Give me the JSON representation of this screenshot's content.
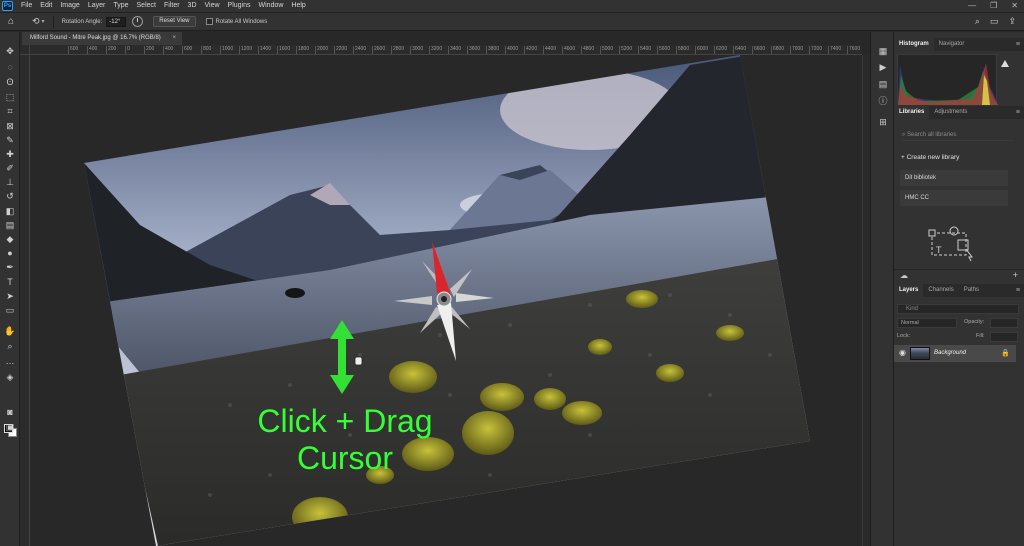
{
  "app": {
    "logo": "Ps",
    "menu": [
      "File",
      "Edit",
      "Image",
      "Layer",
      "Type",
      "Select",
      "Filter",
      "3D",
      "View",
      "Plugins",
      "Window",
      "Help"
    ],
    "window_controls": [
      "—",
      "❐",
      "✕"
    ]
  },
  "options": {
    "rotation_label": "Rotation Angle:",
    "rotation_value": "-12°",
    "reset_view": "Reset View",
    "rotate_all_windows": "Rotate All Windows"
  },
  "document": {
    "tab_title": "Milford Sound - Mitre Peak.jpg @ 16.7% (RGB/8)",
    "tab_close": "×"
  },
  "ruler": {
    "ticks": [
      "600",
      "400",
      "200",
      "0",
      "200",
      "400",
      "600",
      "800",
      "1000",
      "1200",
      "1400",
      "1600",
      "1800",
      "2000",
      "2200",
      "2400",
      "2600",
      "2800",
      "3000",
      "3200",
      "3400",
      "3600",
      "3800",
      "4000",
      "4200",
      "4400",
      "4600",
      "4800",
      "5000",
      "5200",
      "5400",
      "5600",
      "5800",
      "6000",
      "6200",
      "6400",
      "6600",
      "6800",
      "7000",
      "7200",
      "7400",
      "7600",
      "7800"
    ]
  },
  "overlay": {
    "line1": "Click + Drag",
    "line2": "Cursor",
    "color": "#35ff35"
  },
  "panels": {
    "top_tabs": [
      "Histogram",
      "Navigator"
    ],
    "library_tabs": [
      "Libraries",
      "Adjustments"
    ],
    "library_search_placeholder": "Search all libraries",
    "create_library": "Create new library",
    "libraries": [
      "Dit bibliotek",
      "HMC CC"
    ],
    "layer_tabs": [
      "Layers",
      "Channels",
      "Paths"
    ],
    "layer_search": "Kind",
    "blend_mode": "Normal",
    "opacity_label": "Opacity:",
    "lock_label": "Lock:",
    "fill_label": "Fill:",
    "layer_name": "Background",
    "panel_menu_icon": "≡"
  }
}
